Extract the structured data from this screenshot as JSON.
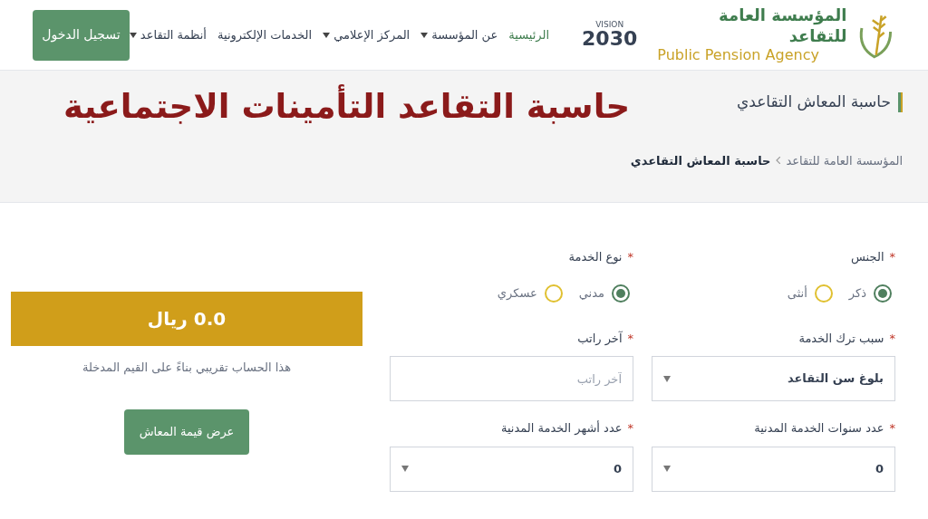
{
  "header": {
    "logo": {
      "title_ar": "المؤسسة العامة للتقاعد",
      "title_en": "Public Pension Agency"
    },
    "vision": {
      "label": "VISION",
      "year": "2030"
    },
    "nav": [
      {
        "label": "الرئيسية",
        "selected": true,
        "dropdown": false
      },
      {
        "label": "عن المؤسسة",
        "selected": false,
        "dropdown": true
      },
      {
        "label": "المركز الإعلامي",
        "selected": false,
        "dropdown": true
      },
      {
        "label": "الخدمات الإلكترونية",
        "selected": false,
        "dropdown": false
      },
      {
        "label": "أنظمة التقاعد",
        "selected": false,
        "dropdown": true
      }
    ],
    "login_button": "تسجيل الدخول"
  },
  "banner": {
    "page_title": "حاسبة المعاش التقاعدي",
    "overlay_title": "حاسبة التقاعد التأمينات الاجتماعية",
    "breadcrumb": [
      {
        "label": "المؤسسة العامة للتقاعد",
        "current": false
      },
      {
        "label": "حاسبة المعاش التقاعدي",
        "current": true
      }
    ]
  },
  "form": {
    "rows": [
      [
        {
          "kind": "radio",
          "label": "الجنس",
          "required_mark": "*",
          "options": [
            {
              "label": "ذكر",
              "selected": true
            },
            {
              "label": "أنثى",
              "selected": false
            }
          ]
        },
        {
          "kind": "radio",
          "label": "نوع الخدمة",
          "required_mark": "*",
          "options": [
            {
              "label": "مدني",
              "selected": true
            },
            {
              "label": "عسكري",
              "selected": false
            }
          ]
        }
      ],
      [
        {
          "kind": "select",
          "label": "سبب ترك الخدمة",
          "required_mark": "*",
          "value": "بلوغ سن التقاعد"
        },
        {
          "kind": "input",
          "label": "آخر راتب",
          "required_mark": "*",
          "placeholder": "آخر راتب"
        }
      ],
      [
        {
          "kind": "select",
          "label": "عدد سنوات الخدمة المدنية",
          "required_mark": "*",
          "value": "0"
        },
        {
          "kind": "select",
          "label": "عدد أشهر الخدمة المدنية",
          "required_mark": "*",
          "value": "0"
        }
      ]
    ]
  },
  "result": {
    "amount": "0.0 ريال",
    "note": "هذا الحساب تقريبي بناءً على القيم المدخلة",
    "button": "عرض قيمة المعاش"
  }
}
